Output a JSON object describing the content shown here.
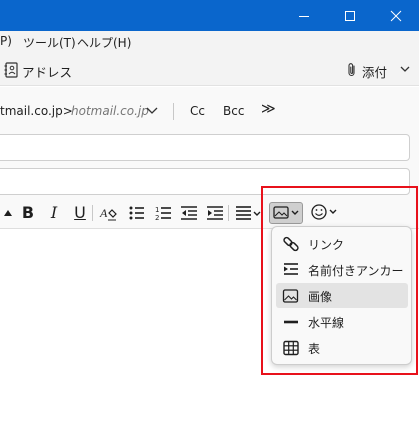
{
  "menu": {
    "items": [
      {
        "label": "P)"
      },
      {
        "label": "ツール(T)"
      },
      {
        "label": "ヘルプ(H)"
      }
    ]
  },
  "toolbar": {
    "address_label": "アドレス",
    "attach_label": "添付"
  },
  "header": {
    "from_visible": "tmail.co.jp>",
    "from_identity": "hotmail.co.jp",
    "cc_label": "Cc",
    "bcc_label": "Bcc",
    "more_label": "≫"
  },
  "format": {
    "bold": "B",
    "italic": "I",
    "underline": "U"
  },
  "insert_menu": {
    "items": [
      {
        "label": "リンク",
        "icon": "link-icon"
      },
      {
        "label": "名前付きアンカー",
        "icon": "anchor-icon"
      },
      {
        "label": "画像",
        "icon": "image-icon",
        "selected": true
      },
      {
        "label": "水平線",
        "icon": "horizontal-line-icon"
      },
      {
        "label": "表",
        "icon": "table-icon"
      }
    ]
  },
  "colors": {
    "titlebar": "#0a66cc",
    "highlight": "#e8111b"
  }
}
